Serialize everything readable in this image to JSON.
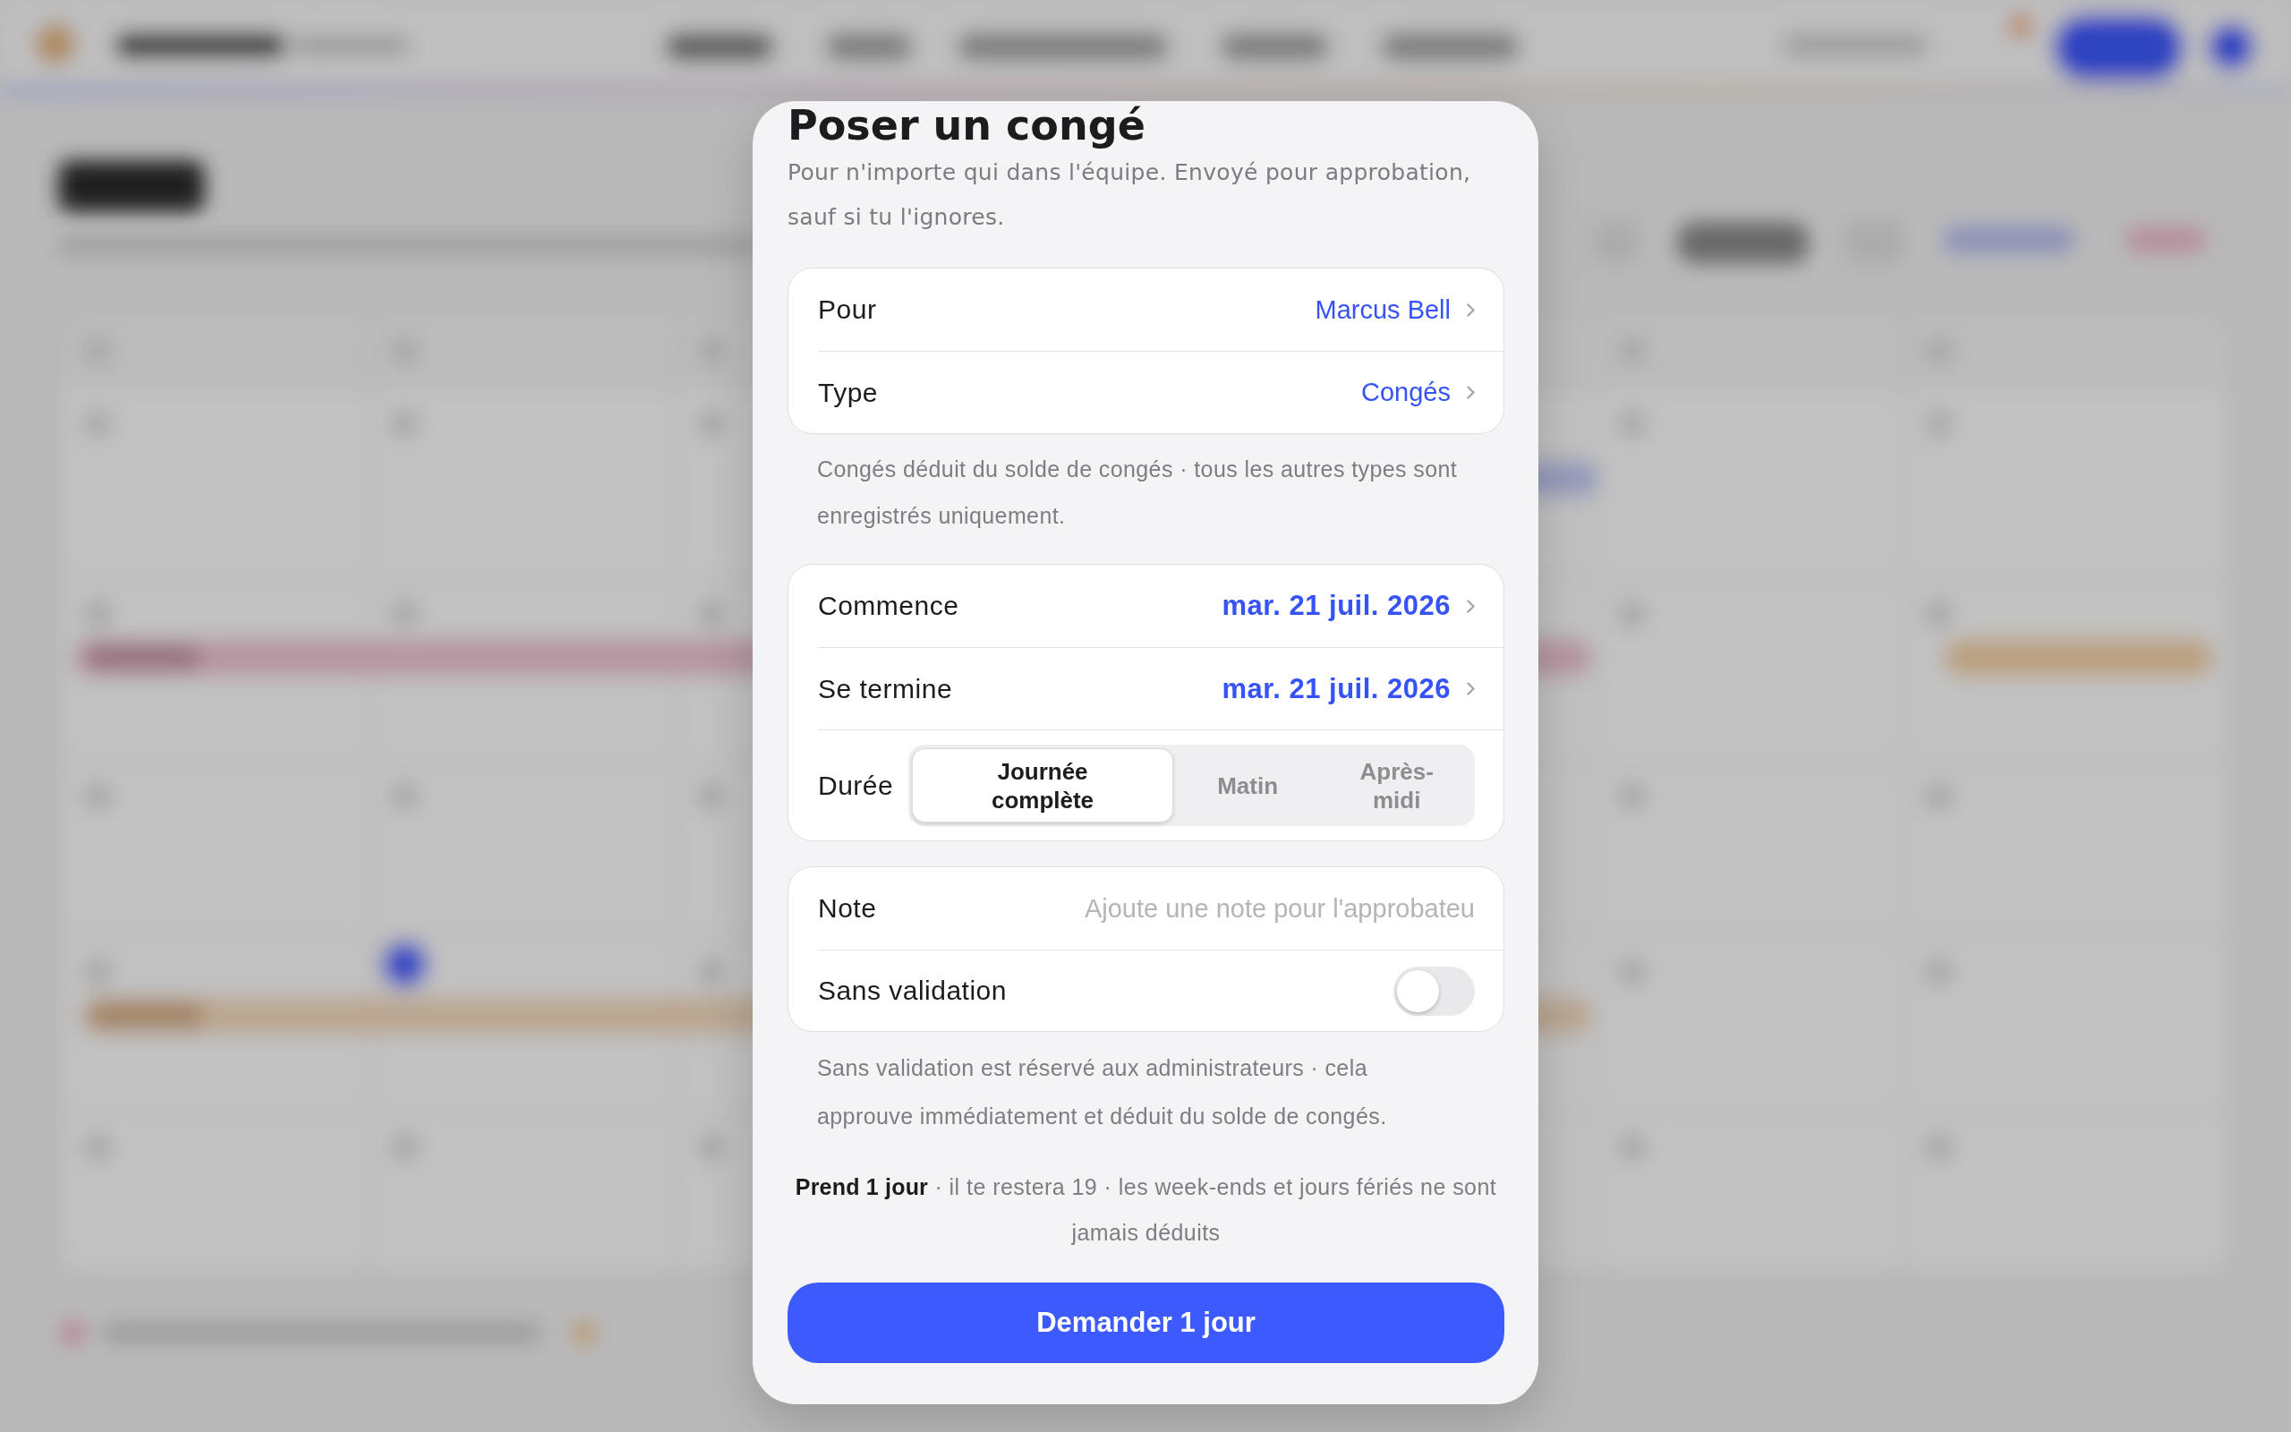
{
  "dialog": {
    "title": "Poser un congé",
    "subtitle": "Pour n'importe qui dans l'équipe. Envoyé pour approbation, sauf si tu l'ignores.",
    "sections": [
      {
        "rows": [
          {
            "kind": "picker",
            "label": "Pour",
            "value": "Marcus Bell"
          },
          {
            "kind": "picker",
            "label": "Type",
            "value": "Congés"
          }
        ],
        "footnote": "Congés déduit du solde de congés · tous les autres types sont enregistrés uniquement."
      },
      {
        "rows": [
          {
            "kind": "date",
            "label": "Commence",
            "value": "mar. 21 juil. 2026"
          },
          {
            "kind": "date",
            "label": "Se termine",
            "value": "mar. 21 juil. 2026"
          },
          {
            "kind": "segmented",
            "label": "Durée",
            "options": [
              {
                "label": "Journée complète",
                "selected": true
              },
              {
                "label": "Matin",
                "selected": false
              },
              {
                "label": "Après-midi",
                "selected": false
              }
            ]
          }
        ]
      },
      {
        "rows": [
          {
            "kind": "text",
            "label": "Note",
            "placeholder": "Ajoute une note pour l'approbateu"
          },
          {
            "kind": "toggle",
            "label": "Sans validation",
            "on": false
          }
        ],
        "footnote": "Sans validation est réservé aux administrateurs · cela approuve immédiatement et déduit du solde de congés."
      }
    ],
    "summary": "**Prend 1 jour** · il te restera 19 · les week-ends et jours fériés ne sont jamais déduits",
    "submit_button": "Demander 1 jour"
  }
}
